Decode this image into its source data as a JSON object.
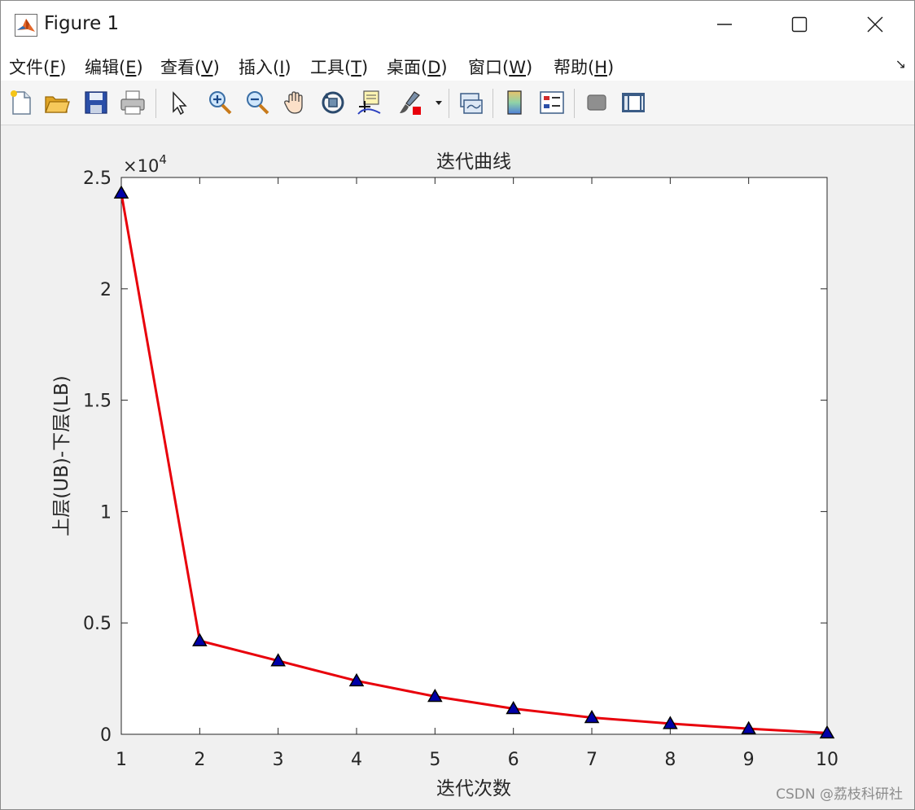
{
  "window": {
    "title": "Figure 1",
    "controls": {
      "minimize": "—",
      "maximize": "☐",
      "close": "✕"
    }
  },
  "menu": [
    {
      "label": "文件(",
      "key": "F",
      "suffix": ")"
    },
    {
      "label": "编辑(",
      "key": "E",
      "suffix": ")"
    },
    {
      "label": "查看(",
      "key": "V",
      "suffix": ")"
    },
    {
      "label": "插入(",
      "key": "I",
      "suffix": ")"
    },
    {
      "label": "工具(",
      "key": "T",
      "suffix": ")"
    },
    {
      "label": "桌面(",
      "key": "D",
      "suffix": ")"
    },
    {
      "label": "窗口(",
      "key": "W",
      "suffix": ")"
    },
    {
      "label": "帮助(",
      "key": "H",
      "suffix": ")"
    }
  ],
  "toolbar_icons": [
    "new-figure-icon",
    "open-icon",
    "save-icon",
    "print-icon",
    "pointer-icon",
    "zoom-in-icon",
    "zoom-out-icon",
    "pan-icon",
    "rotate-3d-icon",
    "data-cursor-icon",
    "brush-icon",
    "link-plot-icon",
    "colorbar-icon",
    "legend-icon",
    "hide-plot-tools-icon",
    "show-plot-tools-icon"
  ],
  "watermark": "CSDN @荔枝科研社",
  "chart_data": {
    "type": "line",
    "title": "迭代曲线",
    "xlabel": "迭代次数",
    "ylabel": "上层(UB)-下层(LB)",
    "exponent_label": "×10",
    "exponent": "4",
    "x": [
      1,
      2,
      3,
      4,
      5,
      6,
      7,
      8,
      9,
      10
    ],
    "series": [
      {
        "values": [
          24300,
          4200,
          3300,
          2400,
          1700,
          1150,
          750,
          480,
          250,
          60
        ],
        "line_color": "#e8000b",
        "marker": "triangle",
        "marker_face": "#0000a8",
        "marker_edge": "#000000"
      }
    ],
    "xlim": [
      1,
      10
    ],
    "ylim": [
      0,
      25000
    ],
    "xticks": [
      "1",
      "2",
      "3",
      "4",
      "5",
      "6",
      "7",
      "8",
      "9",
      "10"
    ],
    "yticks": [
      "0",
      "0.5",
      "1",
      "1.5",
      "2",
      "2.5"
    ],
    "grid": false
  }
}
